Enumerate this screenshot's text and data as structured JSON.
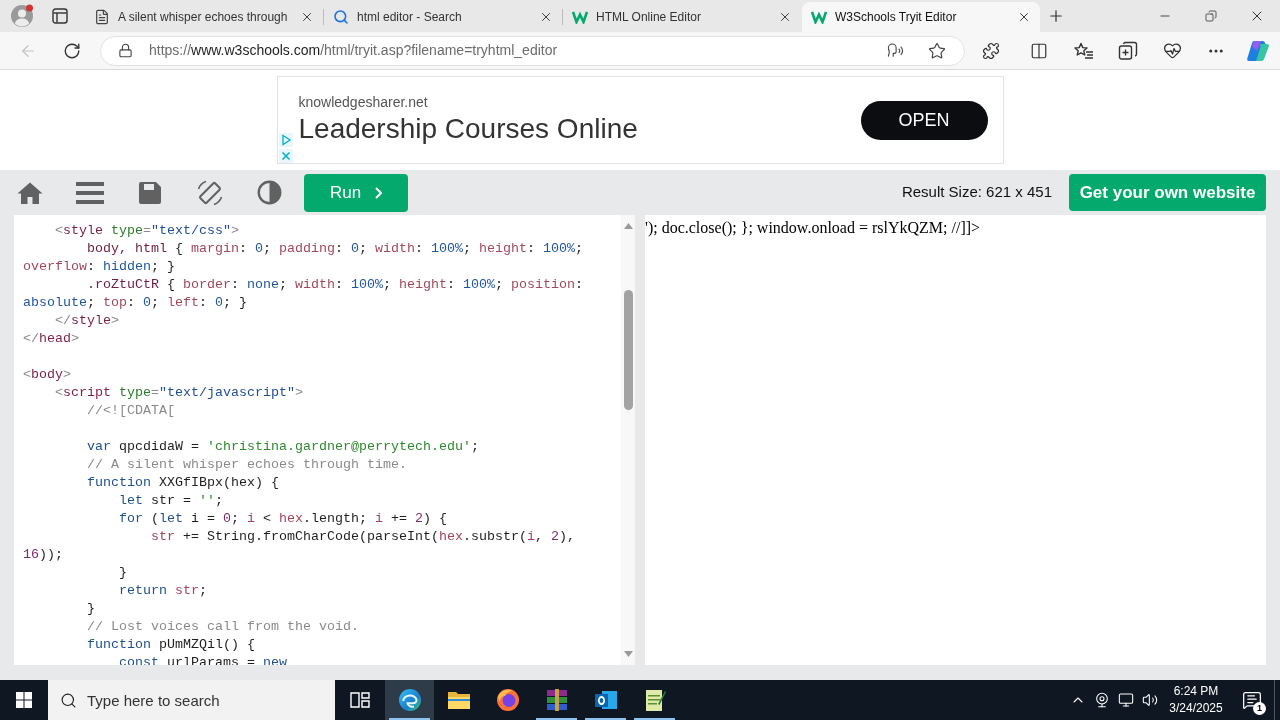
{
  "browser": {
    "tabs": [
      {
        "kind": "page",
        "title": "A silent whisper echoes through",
        "selected": false
      },
      {
        "kind": "search",
        "title": "html editor - Search",
        "selected": false
      },
      {
        "kind": "site",
        "title": "HTML Online Editor",
        "selected": false
      },
      {
        "kind": "site",
        "title": "W3Schools Tryit Editor",
        "selected": true
      }
    ],
    "back_button": {
      "disabled": true
    },
    "address_bar": {
      "scheme": "https://",
      "host": "www.w3schools.com",
      "path": "/html/tryit.asp?filename=tryhtml_editor"
    }
  },
  "ad": {
    "domain": "knowledgesharer.net",
    "headline": "Leadership Courses Online",
    "button": "OPEN"
  },
  "toolbar": {
    "run_button": "Run",
    "result_size": "Result Size: 621 x 451",
    "cta_button": "Get your own website"
  },
  "editor": {
    "lines": [
      {
        "kind": "code",
        "tokens": [
          {
            "kind": "bracket",
            "text": "    <"
          },
          {
            "kind": "tag",
            "text": "style"
          },
          {
            "kind": "attr",
            "text": " type"
          },
          {
            "kind": "bracket",
            "text": "="
          },
          {
            "kind": "string",
            "text": "\"text/css\""
          },
          {
            "kind": "bracket",
            "text": ">"
          }
        ]
      },
      {
        "kind": "code",
        "tokens": [
          {
            "kind": "selector",
            "text": "        body, html"
          },
          {
            "kind": "plain",
            "text": " { "
          },
          {
            "kind": "property",
            "text": "margin"
          },
          {
            "kind": "plain",
            "text": ": "
          },
          {
            "kind": "value",
            "text": "0"
          },
          {
            "kind": "plain",
            "text": "; "
          },
          {
            "kind": "property",
            "text": "padding"
          },
          {
            "kind": "plain",
            "text": ": "
          },
          {
            "kind": "value",
            "text": "0"
          },
          {
            "kind": "plain",
            "text": "; "
          },
          {
            "kind": "property",
            "text": "width"
          },
          {
            "kind": "plain",
            "text": ": "
          },
          {
            "kind": "value",
            "text": "100%"
          },
          {
            "kind": "plain",
            "text": "; "
          },
          {
            "kind": "property",
            "text": "height"
          },
          {
            "kind": "plain",
            "text": ": "
          },
          {
            "kind": "value",
            "text": "100%"
          },
          {
            "kind": "plain",
            "text": ";"
          }
        ]
      },
      {
        "kind": "code",
        "tokens": [
          {
            "kind": "property",
            "text": "overflow"
          },
          {
            "kind": "plain",
            "text": ": "
          },
          {
            "kind": "value",
            "text": "hidden"
          },
          {
            "kind": "plain",
            "text": "; }"
          }
        ]
      },
      {
        "kind": "code",
        "tokens": [
          {
            "kind": "selector",
            "text": "        .roZtuCtR"
          },
          {
            "kind": "plain",
            "text": " { "
          },
          {
            "kind": "property",
            "text": "border"
          },
          {
            "kind": "plain",
            "text": ": "
          },
          {
            "kind": "value",
            "text": "none"
          },
          {
            "kind": "plain",
            "text": "; "
          },
          {
            "kind": "property",
            "text": "width"
          },
          {
            "kind": "plain",
            "text": ": "
          },
          {
            "kind": "value",
            "text": "100%"
          },
          {
            "kind": "plain",
            "text": "; "
          },
          {
            "kind": "property",
            "text": "height"
          },
          {
            "kind": "plain",
            "text": ": "
          },
          {
            "kind": "value",
            "text": "100%"
          },
          {
            "kind": "plain",
            "text": "; "
          },
          {
            "kind": "property",
            "text": "position"
          },
          {
            "kind": "plain",
            "text": ":"
          }
        ]
      },
      {
        "kind": "code",
        "tokens": [
          {
            "kind": "value",
            "text": "absolute"
          },
          {
            "kind": "plain",
            "text": "; "
          },
          {
            "kind": "property",
            "text": "top"
          },
          {
            "kind": "plain",
            "text": ": "
          },
          {
            "kind": "value",
            "text": "0"
          },
          {
            "kind": "plain",
            "text": "; "
          },
          {
            "kind": "property",
            "text": "left"
          },
          {
            "kind": "plain",
            "text": ": "
          },
          {
            "kind": "value",
            "text": "0"
          },
          {
            "kind": "plain",
            "text": "; }"
          }
        ]
      },
      {
        "kind": "code",
        "tokens": [
          {
            "kind": "bracket",
            "text": "    </"
          },
          {
            "kind": "tag",
            "text": "style"
          },
          {
            "kind": "bracket",
            "text": ">"
          }
        ]
      },
      {
        "kind": "code",
        "tokens": [
          {
            "kind": "bracket",
            "text": "</"
          },
          {
            "kind": "tag",
            "text": "head"
          },
          {
            "kind": "bracket",
            "text": ">"
          }
        ]
      },
      {
        "kind": "blank"
      },
      {
        "kind": "code",
        "tokens": [
          {
            "kind": "bracket",
            "text": "<"
          },
          {
            "kind": "tag",
            "text": "body"
          },
          {
            "kind": "bracket",
            "text": ">"
          }
        ]
      },
      {
        "kind": "code",
        "tokens": [
          {
            "kind": "bracket",
            "text": "    <"
          },
          {
            "kind": "tag",
            "text": "script"
          },
          {
            "kind": "attr",
            "text": " type"
          },
          {
            "kind": "bracket",
            "text": "="
          },
          {
            "kind": "string",
            "text": "\"text/javascript\""
          },
          {
            "kind": "bracket",
            "text": ">"
          }
        ]
      },
      {
        "kind": "code",
        "tokens": [
          {
            "kind": "comment",
            "text": "        //<![CDATA["
          }
        ]
      },
      {
        "kind": "blank"
      },
      {
        "kind": "code",
        "tokens": [
          {
            "kind": "keyword",
            "text": "        var"
          },
          {
            "kind": "plain",
            "text": " qpcdidaW = "
          },
          {
            "kind": "jsstring",
            "text": "'christina.gardner@perrytech.edu'"
          },
          {
            "kind": "plain",
            "text": ";"
          }
        ]
      },
      {
        "kind": "code",
        "tokens": [
          {
            "kind": "comment",
            "text": "        // A silent whisper echoes through time."
          }
        ]
      },
      {
        "kind": "code",
        "tokens": [
          {
            "kind": "keyword",
            "text": "        function"
          },
          {
            "kind": "plain",
            "text": " XXGfIBpx(hex) {"
          }
        ]
      },
      {
        "kind": "code",
        "tokens": [
          {
            "kind": "keyword",
            "text": "            let"
          },
          {
            "kind": "plain",
            "text": " str = "
          },
          {
            "kind": "jsstring",
            "text": "''"
          },
          {
            "kind": "plain",
            "text": ";"
          }
        ]
      },
      {
        "kind": "code",
        "tokens": [
          {
            "kind": "keyword",
            "text": "            for"
          },
          {
            "kind": "plain",
            "text": " ("
          },
          {
            "kind": "keyword",
            "text": "let"
          },
          {
            "kind": "plain",
            "text": " i = "
          },
          {
            "kind": "number",
            "text": "0"
          },
          {
            "kind": "plain",
            "text": "; "
          },
          {
            "kind": "local",
            "text": "i"
          },
          {
            "kind": "plain",
            "text": " < "
          },
          {
            "kind": "local",
            "text": "hex"
          },
          {
            "kind": "plain",
            "text": ".length; "
          },
          {
            "kind": "local",
            "text": "i"
          },
          {
            "kind": "plain",
            "text": " += "
          },
          {
            "kind": "number",
            "text": "2"
          },
          {
            "kind": "plain",
            "text": ") {"
          }
        ]
      },
      {
        "kind": "code",
        "tokens": [
          {
            "kind": "local",
            "text": "                str"
          },
          {
            "kind": "plain",
            "text": " += String.fromCharCode(parseInt("
          },
          {
            "kind": "local",
            "text": "hex"
          },
          {
            "kind": "plain",
            "text": ".substr("
          },
          {
            "kind": "local",
            "text": "i"
          },
          {
            "kind": "plain",
            "text": ", "
          },
          {
            "kind": "number",
            "text": "2"
          },
          {
            "kind": "plain",
            "text": "),"
          }
        ]
      },
      {
        "kind": "code",
        "tokens": [
          {
            "kind": "number",
            "text": "16"
          },
          {
            "kind": "plain",
            "text": "));"
          }
        ]
      },
      {
        "kind": "code",
        "tokens": [
          {
            "kind": "plain",
            "text": "            }"
          }
        ]
      },
      {
        "kind": "code",
        "tokens": [
          {
            "kind": "keyword",
            "text": "            return"
          },
          {
            "kind": "local",
            "text": " str"
          },
          {
            "kind": "plain",
            "text": ";"
          }
        ]
      },
      {
        "kind": "code",
        "tokens": [
          {
            "kind": "plain",
            "text": "        }"
          }
        ]
      },
      {
        "kind": "code",
        "tokens": [
          {
            "kind": "comment",
            "text": "        // Lost voices call from the void."
          }
        ]
      },
      {
        "kind": "code",
        "tokens": [
          {
            "kind": "keyword",
            "text": "        function"
          },
          {
            "kind": "plain",
            "text": " pUmMZQil() {"
          }
        ]
      },
      {
        "kind": "code",
        "tokens": [
          {
            "kind": "keyword",
            "text": "            const"
          },
          {
            "kind": "plain",
            "text": " urlParams = "
          },
          {
            "kind": "keyword",
            "text": "new"
          }
        ]
      }
    ]
  },
  "result": {
    "text": "'); doc.close(); }; window.onload = rslYkQZM; //]]>"
  },
  "taskbar": {
    "search": {
      "placeholder": "Type here to search"
    },
    "apps": [
      {
        "kind": "browser",
        "selected": true,
        "running": true
      },
      {
        "kind": "folder",
        "selected": false,
        "running": false
      },
      {
        "kind": "globe",
        "selected": false,
        "running": false
      },
      {
        "kind": "archive",
        "selected": false,
        "running": true
      },
      {
        "kind": "mail",
        "selected": false,
        "running": true
      },
      {
        "kind": "notepad",
        "selected": false,
        "running": true
      }
    ],
    "time": "6:24 PM",
    "date": "3/24/2025",
    "notification_count": "1"
  }
}
